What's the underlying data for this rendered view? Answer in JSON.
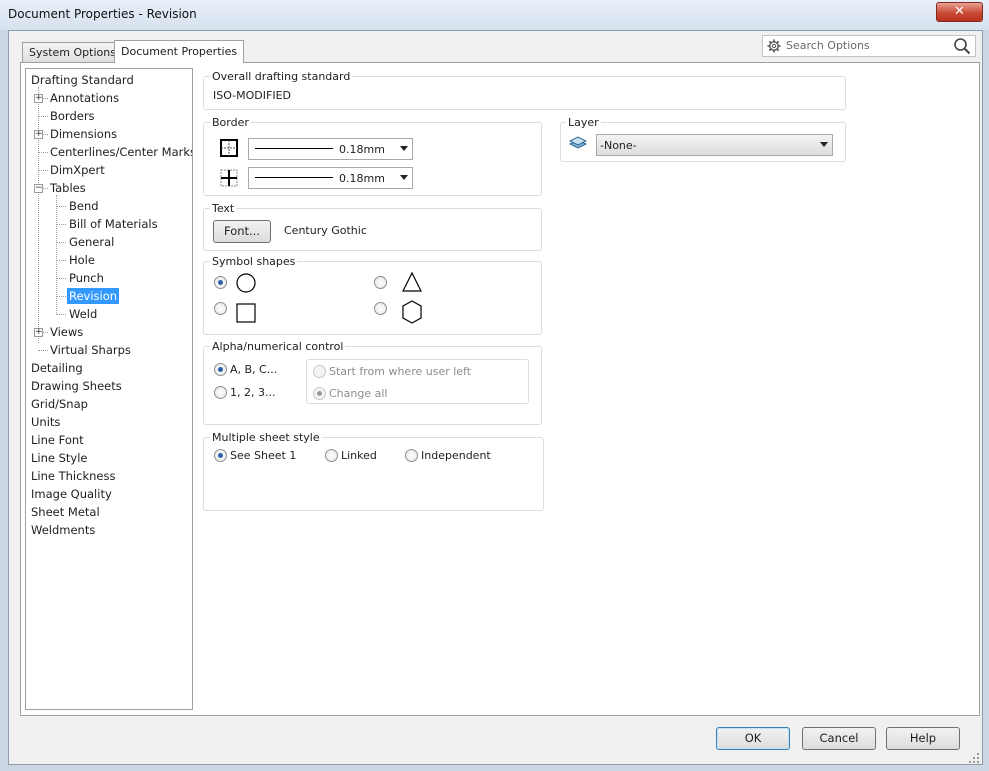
{
  "window": {
    "title": "Document Properties - Revision",
    "close_glyph": "✕"
  },
  "tabs": [
    {
      "label": "System Options",
      "active": false
    },
    {
      "label": "Document Properties",
      "active": true
    }
  ],
  "search": {
    "placeholder": "Search Options",
    "icon": "gear-icon"
  },
  "tree": {
    "items": [
      {
        "label": "Drafting Standard"
      },
      {
        "label": "Annotations",
        "expander": "+"
      },
      {
        "label": "Borders"
      },
      {
        "label": "Dimensions",
        "expander": "+"
      },
      {
        "label": "Centerlines/Center Marks"
      },
      {
        "label": "DimXpert"
      },
      {
        "label": "Tables",
        "expander": "−"
      },
      {
        "label": "Bend"
      },
      {
        "label": "Bill of Materials"
      },
      {
        "label": "General"
      },
      {
        "label": "Hole"
      },
      {
        "label": "Punch"
      },
      {
        "label": "Revision",
        "selected": true
      },
      {
        "label": "Weld"
      },
      {
        "label": "Views",
        "expander": "+"
      },
      {
        "label": "Virtual Sharps"
      },
      {
        "label": "Detailing"
      },
      {
        "label": "Drawing Sheets"
      },
      {
        "label": "Grid/Snap"
      },
      {
        "label": "Units"
      },
      {
        "label": "Line Font"
      },
      {
        "label": "Line Style"
      },
      {
        "label": "Line Thickness"
      },
      {
        "label": "Image Quality"
      },
      {
        "label": "Sheet Metal"
      },
      {
        "label": "Weldments"
      }
    ]
  },
  "drafting_standard": {
    "label": "Overall drafting standard",
    "value": "ISO-MODIFIED"
  },
  "border": {
    "label": "Border",
    "outer_thickness": "0.18mm",
    "inner_thickness": "0.18mm"
  },
  "layer": {
    "label": "Layer",
    "value": "-None-"
  },
  "text": {
    "label": "Text",
    "font_button": "Font...",
    "font_name": "Century Gothic"
  },
  "symbol_shapes": {
    "label": "Symbol shapes",
    "options": [
      {
        "shape": "circle",
        "selected": true
      },
      {
        "shape": "triangle",
        "selected": false
      },
      {
        "shape": "square",
        "selected": false
      },
      {
        "shape": "hexagon",
        "selected": false
      }
    ]
  },
  "alpha_numerical": {
    "label": "Alpha/numerical control",
    "options": [
      {
        "label": "A, B, C...",
        "selected": true
      },
      {
        "label": "1, 2, 3...",
        "selected": false
      }
    ],
    "sub_options": [
      {
        "label": "Start from where user left",
        "selected": false,
        "disabled": true
      },
      {
        "label": "Change all",
        "selected": true,
        "disabled": true
      }
    ]
  },
  "multiple_sheet_style": {
    "label": "Multiple sheet style",
    "options": [
      {
        "label": "See Sheet 1",
        "selected": true
      },
      {
        "label": "Linked",
        "selected": false
      },
      {
        "label": "Independent",
        "selected": false
      }
    ]
  },
  "footer": {
    "ok": "OK",
    "cancel": "Cancel",
    "help": "Help"
  }
}
